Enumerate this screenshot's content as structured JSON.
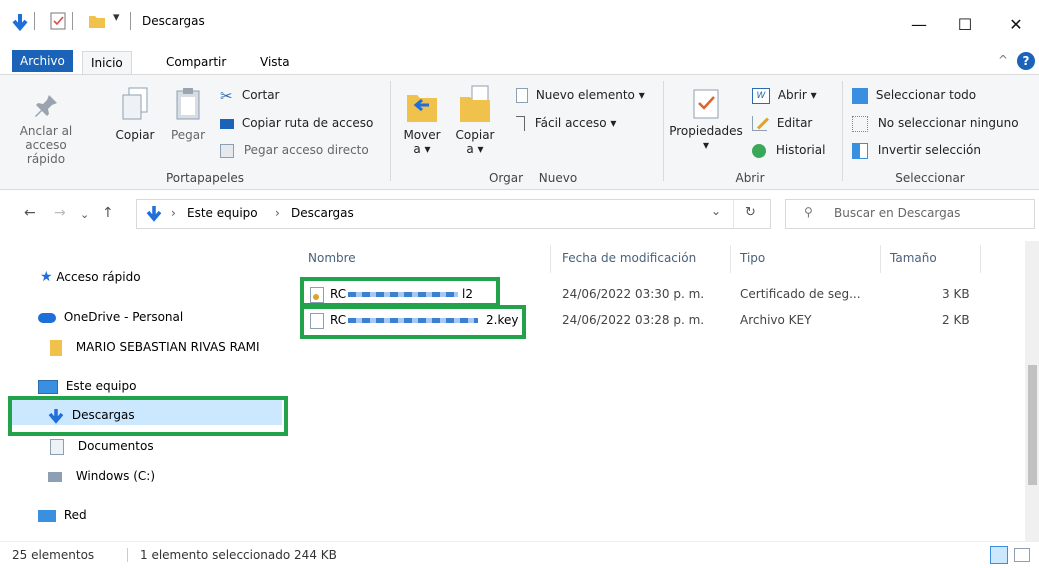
{
  "window": {
    "title": "Descargas",
    "minimize": "—",
    "maximize": "☐",
    "close": "✕"
  },
  "tabs": {
    "file": "Archivo",
    "home": "Inicio",
    "share": "Compartir",
    "view": "Vista"
  },
  "ribbon": {
    "clipboard": {
      "pin_line1": "Anclar al",
      "pin_line2": "acceso rápido",
      "copy": "Copiar",
      "paste": "Pegar",
      "cut": "Cortar",
      "copy_path": "Copiar ruta de acceso",
      "paste_shortcut": "Pegar acceso directo",
      "group": "Portapapeles"
    },
    "organize": {
      "move_line1": "Mover",
      "move_line2": "a ▾",
      "copy_line1": "Copiar",
      "copy_line2": "a ▾",
      "group": "Orgar"
    },
    "new": {
      "new_item": "Nuevo elemento ▾",
      "easy_access": "Fácil acceso ▾",
      "group": "Nuevo"
    },
    "open": {
      "properties": "Propiedades",
      "properties_arrow": "▾",
      "open": "Abrir ▾",
      "edit": "Editar",
      "history": "Historial",
      "group": "Abrir"
    },
    "select": {
      "select_all": "Seleccionar todo",
      "select_none": "No seleccionar ninguno",
      "invert": "Invertir selección",
      "group": "Seleccionar"
    }
  },
  "address": {
    "path_root": "Este equipo",
    "path_sep": "›",
    "path_current": "Descargas",
    "search_placeholder": "Buscar en Descargas"
  },
  "nav": {
    "quick_access": "Acceso rápido",
    "onedrive": "OneDrive - Personal",
    "user_folder": "MARIO SEBASTIAN RIVAS RAMI",
    "this_pc": "Este equipo",
    "downloads": "Descargas",
    "documents": "Documentos",
    "windows": "Windows (C:)",
    "network": "Red"
  },
  "columns": {
    "name": "Nombre",
    "modified": "Fecha de modificación",
    "type": "Tipo",
    "size": "Tamaño"
  },
  "files": [
    {
      "name_prefix": "RC",
      "name_suffix": "l2",
      "modified": "24/06/2022 03:30 p. m.",
      "type": "Certificado de seg...",
      "size": "3 KB"
    },
    {
      "name_prefix": "RC",
      "name_suffix": "2.key",
      "modified": "24/06/2022 03:28 p. m.",
      "type": "Archivo KEY",
      "size": "2 KB"
    }
  ],
  "status": {
    "count": "25 elementos",
    "selection": "1 elemento seleccionado  244 KB"
  },
  "colors": {
    "accent": "#1a63b8",
    "highlight": "#22a24a",
    "folder": "#f0c24b"
  }
}
